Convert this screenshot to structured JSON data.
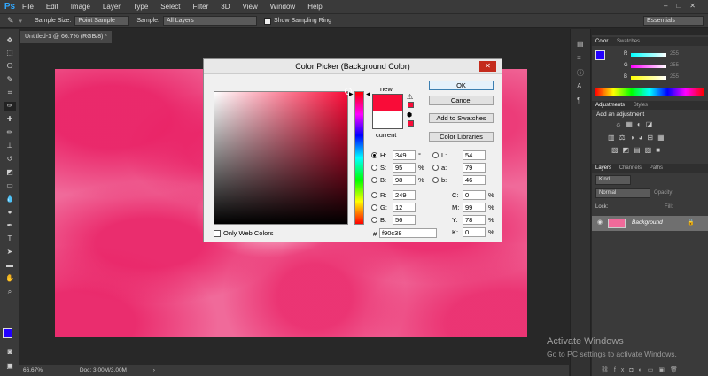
{
  "app": {
    "logo": "Ps"
  },
  "menu": [
    "File",
    "Edit",
    "Image",
    "Layer",
    "Type",
    "Select",
    "Filter",
    "3D",
    "View",
    "Window",
    "Help"
  ],
  "options": {
    "sample_size_label": "Sample Size:",
    "sample_size_value": "Point Sample",
    "sample_label": "Sample:",
    "sample_value": "All Layers",
    "show_ring_label": "Show Sampling Ring",
    "workspace": "Essentials"
  },
  "doc_tab": "Untitled-1 @ 66.7% (RGB/8) *",
  "status": {
    "zoom": "66.67%",
    "doc": "Doc: 3.00M/3.00M"
  },
  "dialog": {
    "title": "Color Picker (Background Color)",
    "ok": "OK",
    "cancel": "Cancel",
    "add_swatches": "Add to Swatches",
    "color_libraries": "Color Libraries",
    "new_label": "new",
    "current_label": "current",
    "only_web": "Only Web Colors",
    "H": "349",
    "S": "95",
    "B": "98",
    "R": "249",
    "G": "12",
    "Bv": "56",
    "L": "54",
    "a": "79",
    "b": "46",
    "C": "0",
    "M": "99",
    "Y": "78",
    "K": "0",
    "hex": "f90c38",
    "deg": "°",
    "pct": "%"
  },
  "right": {
    "color_tab": "Color",
    "swatches_tab": "Swatches",
    "R": "R",
    "G": "G",
    "B": "B",
    "rv": "255",
    "gv": "255",
    "bv": "255",
    "adjustments_tab": "Adjustments",
    "styles_tab": "Styles",
    "add_adjustment": "Add an adjustment",
    "layers_tab": "Layers",
    "channels_tab": "Channels",
    "paths_tab": "Paths",
    "kind": "Kind",
    "blend": "Normal",
    "opacity_label": "Opacity:",
    "lock_label": "Lock:",
    "fill_label": "Fill:",
    "layer_name": "Background"
  },
  "colors": {
    "new": "#f90c38",
    "current": "#ffffff",
    "fg": "#2200ff"
  },
  "watermark": {
    "line1": "Activate Windows",
    "line2": "Go to PC settings to activate Windows."
  }
}
